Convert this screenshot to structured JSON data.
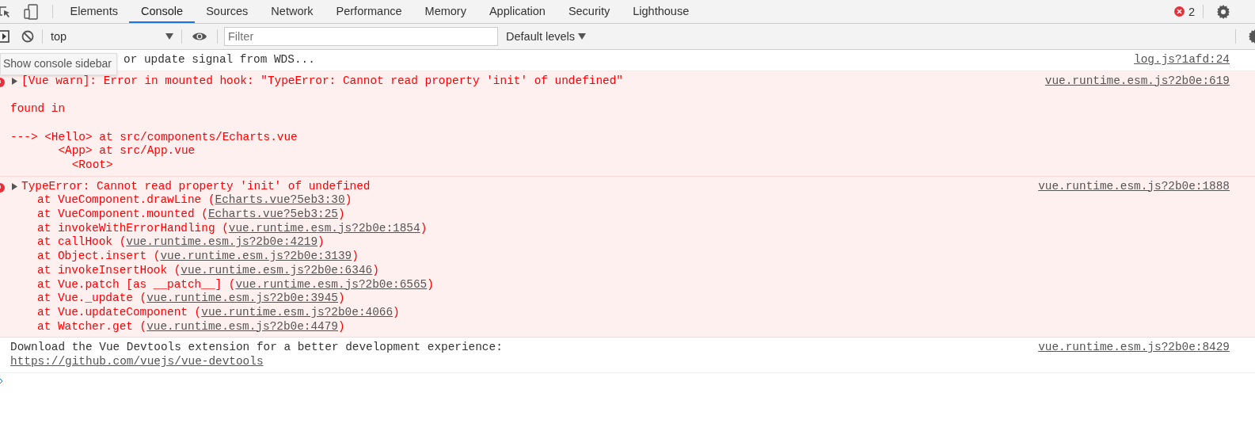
{
  "tabs": [
    {
      "label": "Elements",
      "selected": false
    },
    {
      "label": "Console",
      "selected": true
    },
    {
      "label": "Sources",
      "selected": false
    },
    {
      "label": "Network",
      "selected": false
    },
    {
      "label": "Performance",
      "selected": false
    },
    {
      "label": "Memory",
      "selected": false
    },
    {
      "label": "Application",
      "selected": false
    },
    {
      "label": "Security",
      "selected": false
    },
    {
      "label": "Lighthouse",
      "selected": false
    }
  ],
  "error_count": "2",
  "toolbar": {
    "context": "top",
    "filter": {
      "placeholder": "Filter"
    },
    "levels": "Default levels"
  },
  "tooltip": "Show console sidebar",
  "messages": [
    {
      "kind": "log",
      "text": "or update signal from WDS...",
      "source": "log.js?1afd:24"
    },
    {
      "kind": "warn",
      "expanded": false,
      "head": "[Vue warn]: Error in mounted hook: \"TypeError: Cannot read property 'init' of undefined\"",
      "body": "found in\n\n---> <Hello> at src/components/Echarts.vue\n       <App> at src/App.vue\n         <Root>",
      "source": "vue.runtime.esm.js?2b0e:619"
    },
    {
      "kind": "error",
      "expanded": false,
      "head": "TypeError: Cannot read property 'init' of undefined",
      "source": "vue.runtime.esm.js?2b0e:1888",
      "frames": [
        {
          "prefix": "at VueComponent.drawLine (",
          "link": "Echarts.vue?5eb3:30",
          "suffix": ")"
        },
        {
          "prefix": "at VueComponent.mounted (",
          "link": "Echarts.vue?5eb3:25",
          "suffix": ")"
        },
        {
          "prefix": "at invokeWithErrorHandling (",
          "link": "vue.runtime.esm.js?2b0e:1854",
          "suffix": ")"
        },
        {
          "prefix": "at callHook (",
          "link": "vue.runtime.esm.js?2b0e:4219",
          "suffix": ")"
        },
        {
          "prefix": "at Object.insert (",
          "link": "vue.runtime.esm.js?2b0e:3139",
          "suffix": ")"
        },
        {
          "prefix": "at invokeInsertHook (",
          "link": "vue.runtime.esm.js?2b0e:6346",
          "suffix": ")"
        },
        {
          "prefix": "at Vue.patch [as __patch__] (",
          "link": "vue.runtime.esm.js?2b0e:6565",
          "suffix": ")"
        },
        {
          "prefix": "at Vue._update (",
          "link": "vue.runtime.esm.js?2b0e:3945",
          "suffix": ")"
        },
        {
          "prefix": "at Vue.updateComponent (",
          "link": "vue.runtime.esm.js?2b0e:4066",
          "suffix": ")"
        },
        {
          "prefix": "at Watcher.get (",
          "link": "vue.runtime.esm.js?2b0e:4479",
          "suffix": ")"
        }
      ]
    },
    {
      "kind": "info",
      "text": "Download the Vue Devtools extension for a better development experience:",
      "link": "https://github.com/vuejs/vue-devtools",
      "source": "vue.runtime.esm.js?2b0e:8429"
    }
  ]
}
